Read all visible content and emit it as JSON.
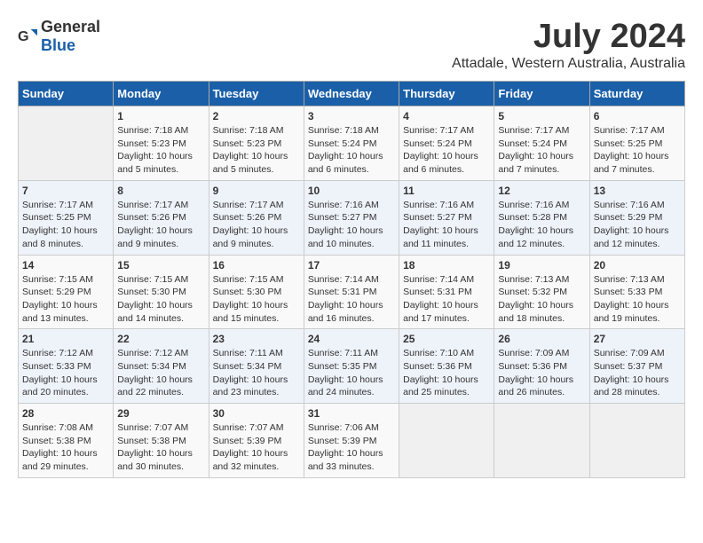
{
  "header": {
    "logo_general": "General",
    "logo_blue": "Blue",
    "title": "July 2024",
    "subtitle": "Attadale, Western Australia, Australia"
  },
  "weekdays": [
    "Sunday",
    "Monday",
    "Tuesday",
    "Wednesday",
    "Thursday",
    "Friday",
    "Saturday"
  ],
  "weeks": [
    [
      {
        "day": "",
        "empty": true
      },
      {
        "day": "1",
        "sunrise": "7:18 AM",
        "sunset": "5:23 PM",
        "daylight": "10 hours and 5 minutes."
      },
      {
        "day": "2",
        "sunrise": "7:18 AM",
        "sunset": "5:23 PM",
        "daylight": "10 hours and 5 minutes."
      },
      {
        "day": "3",
        "sunrise": "7:18 AM",
        "sunset": "5:24 PM",
        "daylight": "10 hours and 6 minutes."
      },
      {
        "day": "4",
        "sunrise": "7:17 AM",
        "sunset": "5:24 PM",
        "daylight": "10 hours and 6 minutes."
      },
      {
        "day": "5",
        "sunrise": "7:17 AM",
        "sunset": "5:24 PM",
        "daylight": "10 hours and 7 minutes."
      },
      {
        "day": "6",
        "sunrise": "7:17 AM",
        "sunset": "5:25 PM",
        "daylight": "10 hours and 7 minutes."
      }
    ],
    [
      {
        "day": "7",
        "sunrise": "7:17 AM",
        "sunset": "5:25 PM",
        "daylight": "10 hours and 8 minutes."
      },
      {
        "day": "8",
        "sunrise": "7:17 AM",
        "sunset": "5:26 PM",
        "daylight": "10 hours and 9 minutes."
      },
      {
        "day": "9",
        "sunrise": "7:17 AM",
        "sunset": "5:26 PM",
        "daylight": "10 hours and 9 minutes."
      },
      {
        "day": "10",
        "sunrise": "7:16 AM",
        "sunset": "5:27 PM",
        "daylight": "10 hours and 10 minutes."
      },
      {
        "day": "11",
        "sunrise": "7:16 AM",
        "sunset": "5:27 PM",
        "daylight": "10 hours and 11 minutes."
      },
      {
        "day": "12",
        "sunrise": "7:16 AM",
        "sunset": "5:28 PM",
        "daylight": "10 hours and 12 minutes."
      },
      {
        "day": "13",
        "sunrise": "7:16 AM",
        "sunset": "5:29 PM",
        "daylight": "10 hours and 12 minutes."
      }
    ],
    [
      {
        "day": "14",
        "sunrise": "7:15 AM",
        "sunset": "5:29 PM",
        "daylight": "10 hours and 13 minutes."
      },
      {
        "day": "15",
        "sunrise": "7:15 AM",
        "sunset": "5:30 PM",
        "daylight": "10 hours and 14 minutes."
      },
      {
        "day": "16",
        "sunrise": "7:15 AM",
        "sunset": "5:30 PM",
        "daylight": "10 hours and 15 minutes."
      },
      {
        "day": "17",
        "sunrise": "7:14 AM",
        "sunset": "5:31 PM",
        "daylight": "10 hours and 16 minutes."
      },
      {
        "day": "18",
        "sunrise": "7:14 AM",
        "sunset": "5:31 PM",
        "daylight": "10 hours and 17 minutes."
      },
      {
        "day": "19",
        "sunrise": "7:13 AM",
        "sunset": "5:32 PM",
        "daylight": "10 hours and 18 minutes."
      },
      {
        "day": "20",
        "sunrise": "7:13 AM",
        "sunset": "5:33 PM",
        "daylight": "10 hours and 19 minutes."
      }
    ],
    [
      {
        "day": "21",
        "sunrise": "7:12 AM",
        "sunset": "5:33 PM",
        "daylight": "10 hours and 20 minutes."
      },
      {
        "day": "22",
        "sunrise": "7:12 AM",
        "sunset": "5:34 PM",
        "daylight": "10 hours and 22 minutes."
      },
      {
        "day": "23",
        "sunrise": "7:11 AM",
        "sunset": "5:34 PM",
        "daylight": "10 hours and 23 minutes."
      },
      {
        "day": "24",
        "sunrise": "7:11 AM",
        "sunset": "5:35 PM",
        "daylight": "10 hours and 24 minutes."
      },
      {
        "day": "25",
        "sunrise": "7:10 AM",
        "sunset": "5:36 PM",
        "daylight": "10 hours and 25 minutes."
      },
      {
        "day": "26",
        "sunrise": "7:09 AM",
        "sunset": "5:36 PM",
        "daylight": "10 hours and 26 minutes."
      },
      {
        "day": "27",
        "sunrise": "7:09 AM",
        "sunset": "5:37 PM",
        "daylight": "10 hours and 28 minutes."
      }
    ],
    [
      {
        "day": "28",
        "sunrise": "7:08 AM",
        "sunset": "5:38 PM",
        "daylight": "10 hours and 29 minutes."
      },
      {
        "day": "29",
        "sunrise": "7:07 AM",
        "sunset": "5:38 PM",
        "daylight": "10 hours and 30 minutes."
      },
      {
        "day": "30",
        "sunrise": "7:07 AM",
        "sunset": "5:39 PM",
        "daylight": "10 hours and 32 minutes."
      },
      {
        "day": "31",
        "sunrise": "7:06 AM",
        "sunset": "5:39 PM",
        "daylight": "10 hours and 33 minutes."
      },
      {
        "day": "",
        "empty": true
      },
      {
        "day": "",
        "empty": true
      },
      {
        "day": "",
        "empty": true
      }
    ]
  ]
}
